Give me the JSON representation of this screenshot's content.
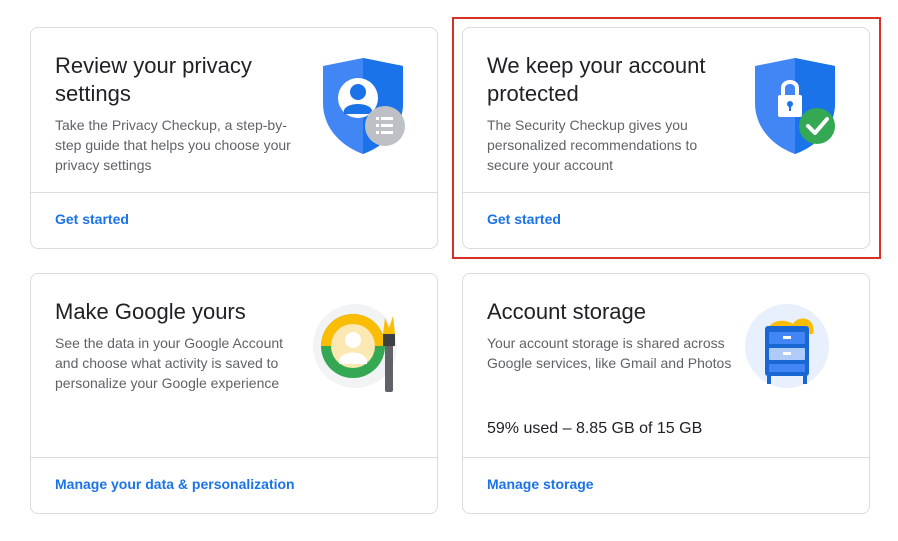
{
  "cards": [
    {
      "id": "privacy",
      "title": "Review your privacy settings",
      "description": "Take the Privacy Checkup, a step-by-step guide that helps you choose your privacy settings",
      "link": "Get started",
      "icon": "privacy-shield-icon"
    },
    {
      "id": "security",
      "title": "We keep your account protected",
      "description": "The Security Checkup gives you personalized recommendations to secure your account",
      "link": "Get started",
      "icon": "security-lock-shield-icon"
    },
    {
      "id": "personalization",
      "title": "Make Google yours",
      "description": "See the data in your Google Account and choose what activity is saved to personalize your Google experience",
      "link": "Manage your data & personalization",
      "icon": "personalization-brush-icon"
    },
    {
      "id": "storage",
      "title": "Account storage",
      "description": "Your account storage is shared across Google services, like Gmail and Photos",
      "usage": "59% used – 8.85 GB of 15 GB",
      "link": "Manage storage",
      "icon": "storage-cabinet-icon"
    }
  ],
  "colors": {
    "link": "#1a73e8",
    "highlight": "#d93025",
    "google_blue": "#4285f4",
    "google_green": "#34a853",
    "google_yellow": "#fbbc04"
  }
}
